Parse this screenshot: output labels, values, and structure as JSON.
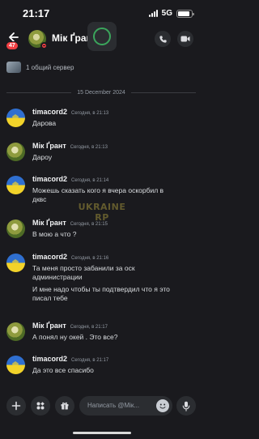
{
  "status_bar": {
    "time": "21:17",
    "network": "5G",
    "battery_level": 0.9
  },
  "header": {
    "title": "Мік Ґрант",
    "unread_badge": "47",
    "back_icon": "arrow-left-icon",
    "call_icon": "phone-icon",
    "video_icon": "video-camera-icon",
    "presence_status": "do-not-disturb",
    "colors": {
      "badge": "#f23f43",
      "presence": "#f23f43",
      "overlay_ring": "#3ba55c"
    }
  },
  "mutual_server": {
    "text": "1 общий сервер"
  },
  "date_divider": "15 December 2024",
  "messages": [
    {
      "author": "timacord2",
      "time": "Сегодня, в 21:13",
      "avatar": "ukraine-flag-avatar",
      "lines": [
        "Дарова"
      ]
    },
    {
      "author": "Мік Ґрант",
      "time": "Сегодня, в 21:13",
      "avatar": "mik-avatar",
      "lines": [
        "Дароу"
      ]
    },
    {
      "author": "timacord2",
      "time": "Сегодня, в 21:14",
      "avatar": "ukraine-flag-avatar",
      "lines": [
        "Можешь сказать кого я вчера оскорбил в",
        "дквс"
      ]
    },
    {
      "author": "Мік Ґрант",
      "time": "Сегодня, в 21:15",
      "avatar": "mik-avatar",
      "lines": [
        "В мою а что ?"
      ]
    },
    {
      "author": "timacord2",
      "time": "Сегодня, в 21:16",
      "avatar": "ukraine-flag-avatar",
      "lines": [
        "Та меня просто забанили за оск",
        "администрации"
      ],
      "extra_lines": [
        "И мне надо чтобы ты подтвердил что я это",
        "писал тебе"
      ]
    },
    {
      "author": "Мік Ґрант",
      "time": "Сегодня, в 21:17",
      "avatar": "mik-avatar",
      "lines": [
        "А понял ну окей . Это все?"
      ]
    },
    {
      "author": "timacord2",
      "time": "Сегодня, в 21:17",
      "avatar": "ukraine-flag-avatar",
      "lines": [
        "Да это все спасибо"
      ]
    }
  ],
  "watermark": {
    "line1": "UKRAINE",
    "line2": "RP"
  },
  "composer": {
    "placeholder": "Написать @Мік...",
    "plus_icon": "plus-icon",
    "apps_icon": "apps-icon",
    "gift_icon": "gift-icon",
    "emoji_icon": "emoji-icon",
    "mic_icon": "microphone-icon"
  }
}
